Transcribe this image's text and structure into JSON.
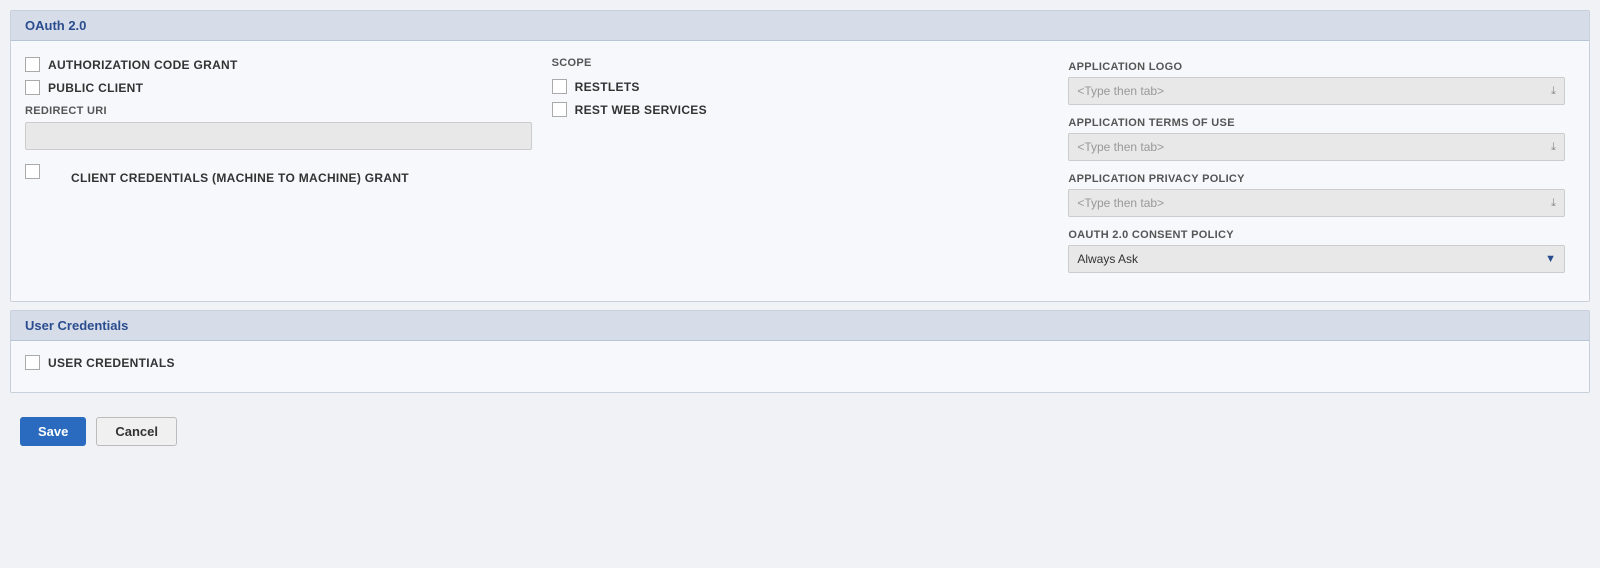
{
  "oauth_section": {
    "title": "OAuth 2.0",
    "col1": {
      "checkbox1_label": "AUTHORIZATION CODE GRANT",
      "checkbox2_label": "PUBLIC CLIENT",
      "redirect_uri_label": "REDIRECT URI",
      "redirect_uri_placeholder": "",
      "client_cred_label": "CLIENT CREDENTIALS (MACHINE TO MACHINE) GRANT"
    },
    "col2": {
      "scope_label": "SCOPE",
      "restlets_label": "RESTLETS",
      "rest_web_services_label": "REST WEB SERVICES"
    },
    "col3": {
      "app_logo_label": "APPLICATION LOGO",
      "app_logo_placeholder": "<Type then tab>",
      "app_terms_label": "APPLICATION TERMS OF USE",
      "app_terms_placeholder": "<Type then tab>",
      "app_privacy_label": "APPLICATION PRIVACY POLICY",
      "app_privacy_placeholder": "<Type then tab>",
      "consent_label": "OAUTH 2.0 CONSENT POLICY",
      "consent_value": "Always Ask"
    }
  },
  "user_credentials_section": {
    "title": "User Credentials",
    "checkbox_label": "USER CREDENTIALS"
  },
  "buttons": {
    "save": "Save",
    "cancel": "Cancel"
  }
}
